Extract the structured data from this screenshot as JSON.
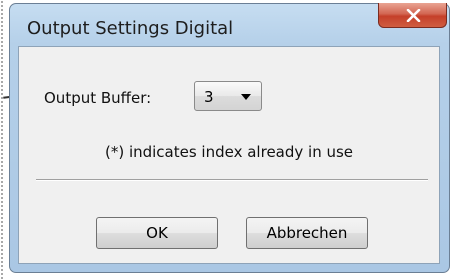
{
  "dialog": {
    "title": "Output Settings Digital",
    "close_icon": "close-x-icon"
  },
  "output_buffer": {
    "label": "Output Buffer:",
    "selected": "3"
  },
  "hint": "(*) indicates index already in use",
  "buttons": {
    "ok": "OK",
    "cancel": "Abbrechen"
  },
  "colors": {
    "frame": "#b5d0e9",
    "close_button": "#c5402a",
    "client": "#f0f0f0"
  }
}
